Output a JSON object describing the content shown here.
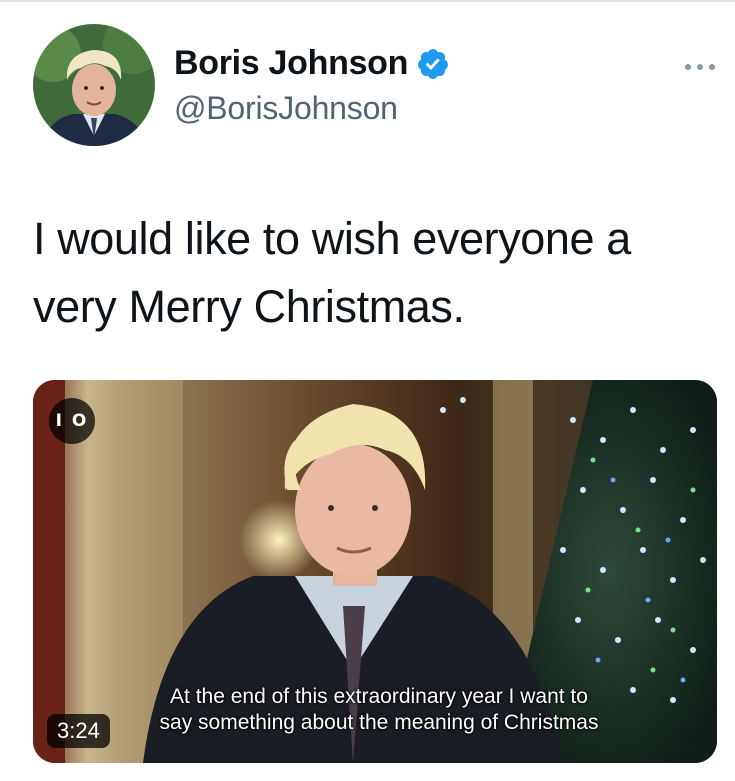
{
  "author": {
    "display_name": "Boris Johnson",
    "handle": "@BorisJohnson",
    "verified": true,
    "verified_color": "#1d9bf0"
  },
  "icons": {
    "avatar": "avatar-photo",
    "verified": "verified-badge-icon",
    "more": "more-options-icon"
  },
  "tweet": {
    "text": "I would like to wish everyone a very Merry Christmas."
  },
  "video": {
    "channel_logo": "I O",
    "subtitle_line1": "At the end of this extraordinary year I want to",
    "subtitle_line2": "say something about the meaning of Christmas",
    "duration": "3:24"
  }
}
